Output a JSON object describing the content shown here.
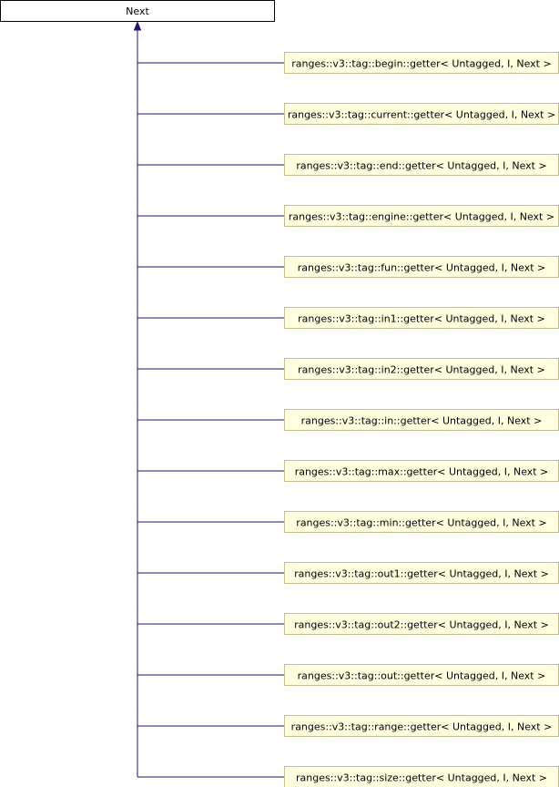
{
  "diagram": {
    "type": "inheritance-graph",
    "root": {
      "label": "Next"
    },
    "children": [
      {
        "label": "ranges::v3::tag::begin::getter< Untagged, I, Next >"
      },
      {
        "label": "ranges::v3::tag::current::getter< Untagged, I, Next >"
      },
      {
        "label": "ranges::v3::tag::end::getter< Untagged, I, Next >"
      },
      {
        "label": "ranges::v3::tag::engine::getter< Untagged, I, Next >"
      },
      {
        "label": "ranges::v3::tag::fun::getter< Untagged, I, Next >"
      },
      {
        "label": "ranges::v3::tag::in1::getter< Untagged, I, Next >"
      },
      {
        "label": "ranges::v3::tag::in2::getter< Untagged, I, Next >"
      },
      {
        "label": "ranges::v3::tag::in::getter< Untagged, I, Next >"
      },
      {
        "label": "ranges::v3::tag::max::getter< Untagged, I, Next >"
      },
      {
        "label": "ranges::v3::tag::min::getter< Untagged, I, Next >"
      },
      {
        "label": "ranges::v3::tag::out1::getter< Untagged, I, Next >"
      },
      {
        "label": "ranges::v3::tag::out2::getter< Untagged, I, Next >"
      },
      {
        "label": "ranges::v3::tag::out::getter< Untagged, I, Next >"
      },
      {
        "label": "ranges::v3::tag::range::getter< Untagged, I, Next >"
      },
      {
        "label": "ranges::v3::tag::size::getter< Untagged, I, Next >"
      }
    ],
    "colors": {
      "edge": "#191970",
      "root_fill": "#ffffff",
      "root_border": "#000000",
      "child_fill": "#ffffe0",
      "child_border": "#bfbf8f"
    }
  }
}
